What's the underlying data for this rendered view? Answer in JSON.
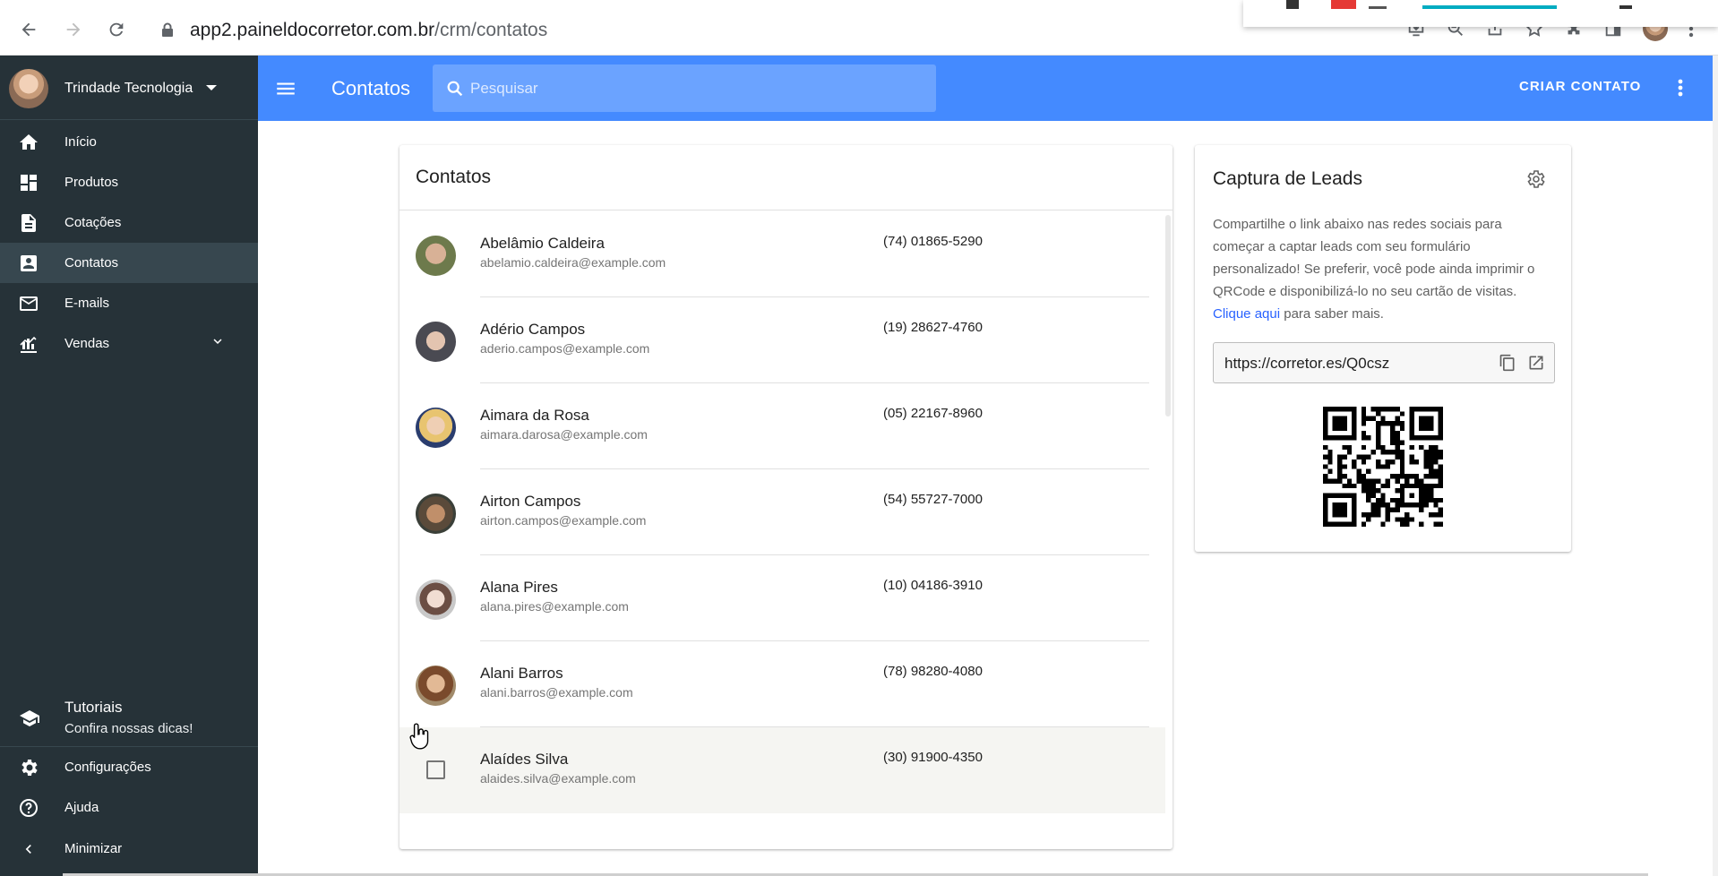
{
  "browser": {
    "url_host": "app2.paineldocorretor.com.br",
    "url_path": "/crm/contatos"
  },
  "sidebar": {
    "account_name": "Trindade Tecnologia",
    "items": [
      {
        "label": "Início",
        "icon": "home-icon"
      },
      {
        "label": "Produtos",
        "icon": "dashboard-icon"
      },
      {
        "label": "Cotações",
        "icon": "document-icon"
      },
      {
        "label": "Contatos",
        "icon": "contact-card-icon",
        "active": true
      },
      {
        "label": "E-mails",
        "icon": "mail-icon"
      },
      {
        "label": "Vendas",
        "icon": "chart-icon"
      }
    ],
    "tutorials_title": "Tutoriais",
    "tutorials_subtitle": "Confira nossas dicas!",
    "settings": "Configurações",
    "help": "Ajuda",
    "minimize": "Minimizar"
  },
  "appbar": {
    "title": "Contatos",
    "search_placeholder": "Pesquisar",
    "create_label": "CRIAR CONTATO",
    "accent_color": "#448aff"
  },
  "contacts": {
    "title": "Contatos",
    "rows": [
      {
        "name": "Abelâmio Caldeira",
        "email": "abelamio.caldeira@example.com",
        "phone": "(74) 01865-5290"
      },
      {
        "name": "Adério Campos",
        "email": "aderio.campos@example.com",
        "phone": "(19) 28627-4760"
      },
      {
        "name": "Aimara da Rosa",
        "email": "aimara.darosa@example.com",
        "phone": "(05) 22167-8960"
      },
      {
        "name": "Airton Campos",
        "email": "airton.campos@example.com",
        "phone": "(54) 55727-7000"
      },
      {
        "name": "Alana Pires",
        "email": "alana.pires@example.com",
        "phone": "(10) 04186-3910"
      },
      {
        "name": "Alani Barros",
        "email": "alani.barros@example.com",
        "phone": "(78) 98280-4080"
      },
      {
        "name": "Alaídes Silva",
        "email": "alaides.silva@example.com",
        "phone": "(30) 91900-4350"
      }
    ]
  },
  "leads": {
    "title": "Captura de Leads",
    "description": "Compartilhe o link abaixo nas redes sociais para começar a captar leads com seu formulário personalizado! Se preferir, você pode ainda imprimir o QRCode e disponibilizá-lo no seu cartão de visitas.",
    "link_text": "Clique aqui",
    "after_link": " para saber mais.",
    "share_url": "https://corretor.es/Q0csz"
  }
}
